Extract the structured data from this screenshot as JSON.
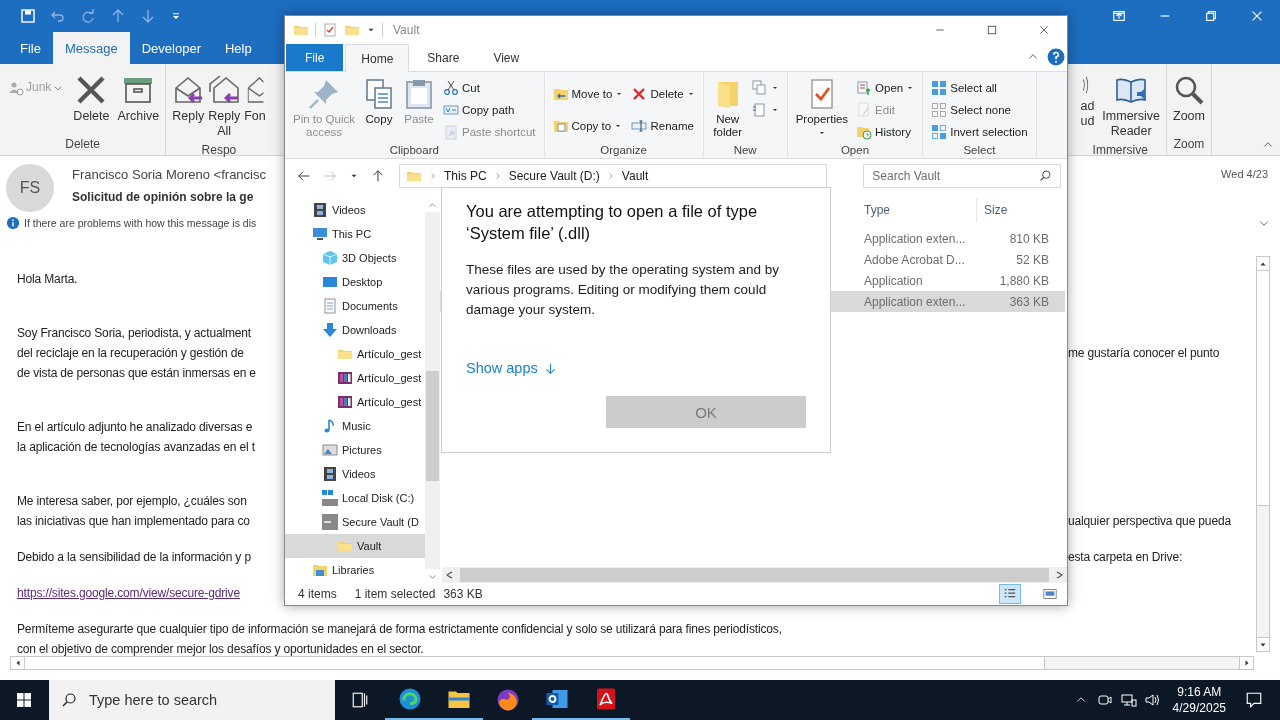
{
  "outlook": {
    "tabs": [
      {
        "label": "File",
        "selected": false
      },
      {
        "label": "Message",
        "selected": true
      },
      {
        "label": "Developer",
        "selected": false
      },
      {
        "label": "Help",
        "selected": false
      }
    ],
    "ribbon": {
      "left_groups": [
        {
          "label": "Delete",
          "buttons": [
            {
              "kind": "small",
              "lines": [
                "Junk"
              ],
              "disabled": true
            },
            {
              "kind": "large",
              "lines": [
                "Delete"
              ],
              "disabled": false
            },
            {
              "kind": "large",
              "lines": [
                "Archive"
              ],
              "disabled": false
            }
          ]
        },
        {
          "label": "Respo",
          "buttons": [
            {
              "kind": "large",
              "lines": [
                "Reply"
              ],
              "disabled": false
            },
            {
              "kind": "large",
              "lines": [
                "Reply",
                "All"
              ],
              "disabled": false
            },
            {
              "kind": "large",
              "lines": [
                "Fon"
              ],
              "disabled": false
            }
          ]
        }
      ],
      "right_groups": [
        {
          "label": "Immersive",
          "buttons": [
            {
              "kind": "large",
              "lines": [
                "ad",
                "ud"
              ],
              "disabled": false
            },
            {
              "kind": "large",
              "lines": [
                "Immersive",
                "Reader"
              ],
              "disabled": false
            }
          ]
        },
        {
          "label": "Zoom",
          "buttons": [
            {
              "kind": "large",
              "lines": [
                "Zoom"
              ],
              "disabled": false
            }
          ]
        }
      ]
    },
    "message": {
      "avatar": "FS",
      "sender": "Francisco Soria Moreno <francisc",
      "subject": "Solicitud de opinión sobre la ge",
      "date": "Wed 4/23",
      "info": "If there are problems with how this message is dis",
      "paragraphs": [
        {
          "kind": "text",
          "lines": [
            {
              "left": "Hola Marta."
            }
          ]
        },
        {
          "kind": "text",
          "lines": [
            {
              "left": "Soy Francisco Soria, periodista, y actualment"
            },
            {
              "left": "del reciclaje en la recuperación y gestión de",
              "right": "me gustaría conocer el punto"
            },
            {
              "left": "de vista de personas que están inmersas en e"
            }
          ]
        },
        {
          "kind": "text",
          "lines": [
            {
              "left": "En el artículo adjunto he analizado diversas e"
            },
            {
              "left": "la aplicación de tecnologías avanzadas en el t"
            }
          ]
        },
        {
          "kind": "text",
          "lines": [
            {
              "left": "Me interesa saber, por ejemplo, ¿cuáles son"
            },
            {
              "left": "las iniciativas  que han implementado para co",
              "right": "ualquier perspectiva que pueda"
            }
          ]
        },
        {
          "kind": "text",
          "lines": [
            {
              "left": "Debido a la sensibilidad de la información y p",
              "right": "esta carpeta en Drive:"
            }
          ]
        },
        {
          "kind": "link",
          "lines": [
            {
              "left": "https://sites.google.com/view/secure-gdrive"
            }
          ]
        },
        {
          "kind": "text",
          "lines": [
            {
              "left": "Permíteme asegurarte que cualquier tipo de información se manejará de forma estrictamente confidencial y solo se utilizará para fines periodísticos,"
            },
            {
              "left": "con el objetivo de comprender mejor los desafíos y oportunidades en el sector."
            }
          ]
        }
      ]
    }
  },
  "explorer": {
    "title": "Vault",
    "tabs": [
      {
        "label": "File",
        "kind": "file",
        "selected": false
      },
      {
        "label": "Home",
        "kind": "tab",
        "selected": true
      },
      {
        "label": "Share",
        "kind": "tab",
        "selected": false
      },
      {
        "label": "View",
        "kind": "tab",
        "selected": false
      }
    ],
    "ribbon_groups": [
      {
        "label": "Clipboard",
        "items": [
          {
            "kind": "large",
            "lines": [
              "Pin to Quick",
              "access"
            ],
            "disabled": true,
            "dropdown": false
          },
          {
            "kind": "large",
            "lines": [
              "Copy"
            ],
            "disabled": false,
            "dropdown": false
          },
          {
            "kind": "large",
            "lines": [
              "Paste"
            ],
            "disabled": true,
            "dropdown": false
          },
          {
            "kind": "stack",
            "items": [
              {
                "label": "Cut",
                "disabled": false,
                "dropdown": false
              },
              {
                "label": "Copy path",
                "disabled": false,
                "dropdown": false
              },
              {
                "label": "Paste shortcut",
                "disabled": true,
                "dropdown": false
              }
            ]
          }
        ]
      },
      {
        "label": "Organize",
        "items": [
          {
            "kind": "stack",
            "items": [
              {
                "label": "Move to",
                "disabled": false,
                "dropdown": true
              },
              {
                "label": "Copy to",
                "disabled": false,
                "dropdown": true
              }
            ]
          },
          {
            "kind": "stack",
            "items": [
              {
                "label": "Delete",
                "disabled": false,
                "dropdown": true
              },
              {
                "label": "Rename",
                "disabled": false,
                "dropdown": false
              }
            ]
          }
        ]
      },
      {
        "label": "New",
        "items": [
          {
            "kind": "large",
            "lines": [
              "New",
              "folder"
            ],
            "disabled": false,
            "dropdown": false
          },
          {
            "kind": "stack",
            "items": [
              {
                "disabled": false,
                "dropdown": true
              },
              {
                "disabled": false,
                "dropdown": true
              }
            ]
          }
        ]
      },
      {
        "label": "Open",
        "items": [
          {
            "kind": "large",
            "lines": [
              "Properties"
            ],
            "disabled": false,
            "dropdown": true
          },
          {
            "kind": "stack",
            "items": [
              {
                "label": "Open",
                "disabled": false,
                "dropdown": true
              },
              {
                "label": "Edit",
                "disabled": true,
                "dropdown": false
              },
              {
                "label": "History",
                "disabled": false,
                "dropdown": false
              }
            ]
          }
        ]
      },
      {
        "label": "Select",
        "items": [
          {
            "kind": "stack",
            "items": [
              {
                "label": "Select all",
                "disabled": false,
                "dropdown": false
              },
              {
                "label": "Select none",
                "disabled": false,
                "dropdown": false
              },
              {
                "label": "Invert selection",
                "disabled": false,
                "dropdown": false
              }
            ]
          }
        ]
      }
    ],
    "address": {
      "crumbs": [
        "This PC",
        "Secure Vault (D:)",
        "Vault"
      ]
    },
    "search": {
      "placeholder": "Search Vault"
    },
    "nav": [
      {
        "label": "Videos",
        "selected": false
      },
      {
        "label": "This PC",
        "selected": false,
        "children": [
          {
            "label": "3D Objects",
            "selected": false
          },
          {
            "label": "Desktop",
            "selected": false
          },
          {
            "label": "Documents",
            "selected": false
          },
          {
            "label": "Downloads",
            "selected": false,
            "children": [
              {
                "label": "Artículo_gest",
                "selected": false
              },
              {
                "label": "Artículo_gest",
                "selected": false
              },
              {
                "label": "Artículo_gest",
                "selected": false
              }
            ]
          },
          {
            "label": "Music",
            "selected": false
          },
          {
            "label": "Pictures",
            "selected": false
          },
          {
            "label": "Videos",
            "selected": false
          },
          {
            "label": "Local Disk (C:)",
            "selected": false
          },
          {
            "label": "Secure Vault (D",
            "selected": false,
            "children": [
              {
                "label": "Vault",
                "selected": true
              }
            ]
          }
        ]
      },
      {
        "label": "Libraries",
        "selected": false
      }
    ],
    "columns": [
      "Type",
      "Size"
    ],
    "files": [
      {
        "type": "Application exten...",
        "size": "810 KB",
        "selected": false
      },
      {
        "type": "Adobe Acrobat D...",
        "size": "52 KB",
        "selected": false
      },
      {
        "type": "Application",
        "size": "1,880 KB",
        "selected": false
      },
      {
        "type": "Application exten...",
        "size": "363 KB",
        "selected": true
      }
    ],
    "status": {
      "count": "4 items",
      "selection": "1 item selected",
      "size": "363 KB"
    },
    "views": [
      {
        "selected": true
      },
      {
        "selected": false
      }
    ]
  },
  "dialog": {
    "title": "You are attempting to open a file of type ‘System file’ (.dll)",
    "body": "These files are used by the operating system and by various programs. Editing or modifying them could damage your system.",
    "link": "Show apps",
    "button": {
      "label": "OK",
      "disabled": true
    }
  },
  "taskbar": {
    "search_placeholder": "Type here to search",
    "apps": [
      {
        "running": true
      },
      {
        "running": true
      },
      {
        "running": false
      },
      {
        "running": true
      },
      {
        "running": true
      }
    ],
    "clock": {
      "time": "9:16 AM",
      "date": "4/29/2025"
    }
  }
}
